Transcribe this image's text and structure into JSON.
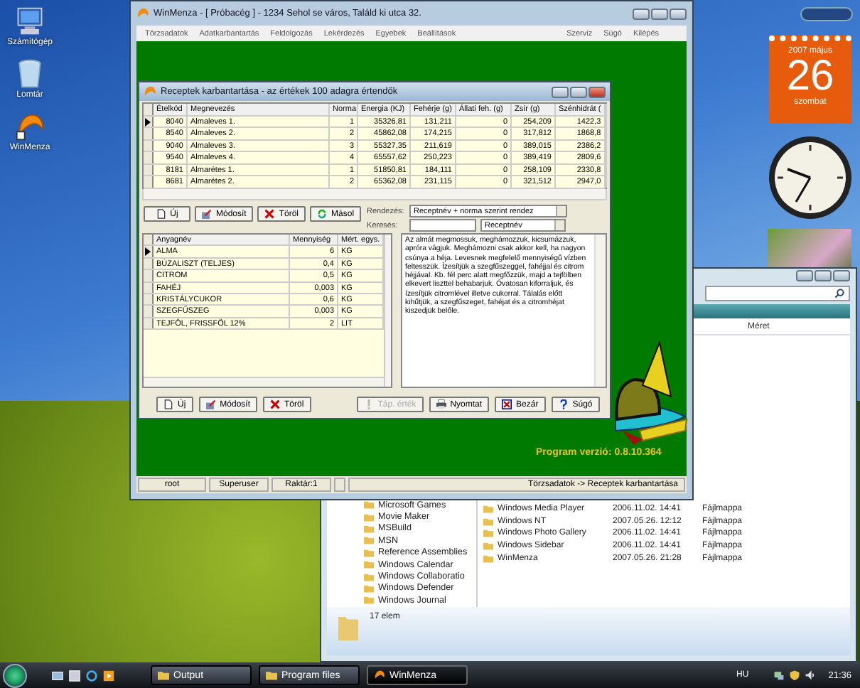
{
  "desktop_icons": [
    {
      "label": "Számítógép",
      "kind": "computer"
    },
    {
      "label": "Lomtár",
      "kind": "bin"
    },
    {
      "label": "WinMenza",
      "kind": "app"
    }
  ],
  "calendar_gadget": {
    "month": "2007 május",
    "day": "26",
    "weekday": "szombat"
  },
  "explorer_window": {
    "column_header": "Méret",
    "folders": [
      "Microsoft Games",
      "Movie Maker",
      "MSBuild",
      "MSN",
      "Reference Assemblies",
      "Windows Calendar",
      "Windows Collaboratio",
      "Windows Defender",
      "Windows Journal"
    ],
    "files": [
      {
        "name": "Windows Media Player",
        "date": "2006.11.02. 14:41",
        "type": "Fájlmappa"
      },
      {
        "name": "Windows NT",
        "date": "2007.05.26. 12:12",
        "type": "Fájlmappa"
      },
      {
        "name": "Windows Photo Gallery",
        "date": "2006.11.02. 14:41",
        "type": "Fájlmappa"
      },
      {
        "name": "Windows Sidebar",
        "date": "2006.11.02. 14:41",
        "type": "Fájlmappa"
      },
      {
        "name": "WinMenza",
        "date": "2007.05.26. 21:28",
        "type": "Fájlmappa"
      }
    ],
    "status": "17 elem"
  },
  "app_window": {
    "title": "WinMenza - [ Próbacég ] - 1234 Sehol se város, Találd ki utca 32.",
    "menu": [
      "Törzsadatok",
      "Adatkarbantartás",
      "Feldolgozás",
      "Lekérdezés",
      "Egyebek",
      "Beállítások",
      "Szerviz",
      "Súgó",
      "Kilépés"
    ],
    "version": "Program verzió:  0.8.10.364",
    "status_left": [
      "root",
      "Superuser",
      "Raktár:1"
    ],
    "status_right": "Törzsadatok -> Receptek karbantartása"
  },
  "dialog": {
    "title": "Receptek karbantartása - az értékek 100 adagra értendők",
    "recipes": {
      "columns": [
        "Ételkód",
        "Megnevezés",
        "Norma",
        "Energia (KJ)",
        "Fehérje (g)",
        "Állati feh. (g)",
        "Zsír (g)",
        "Szénhidrát ("
      ],
      "rows": [
        {
          "selected": true,
          "cells": [
            "8040",
            "Almaleves 1.",
            "1",
            "35326,81",
            "131,211",
            "0",
            "254,209",
            "1422,3"
          ]
        },
        {
          "selected": false,
          "cells": [
            "8540",
            "Almaleves 2.",
            "2",
            "45862,08",
            "174,215",
            "0",
            "317,812",
            "1868,8"
          ]
        },
        {
          "selected": false,
          "cells": [
            "9040",
            "Almaleves 3.",
            "3",
            "55327,35",
            "211,619",
            "0",
            "389,015",
            "2386,2"
          ]
        },
        {
          "selected": false,
          "cells": [
            "9540",
            "Almaleves 4.",
            "4",
            "65557,62",
            "250,223",
            "0",
            "389,419",
            "2809,6"
          ]
        },
        {
          "selected": false,
          "cells": [
            "8181",
            "Almarétes 1.",
            "1",
            "51850,81",
            "184,111",
            "0",
            "258,109",
            "2330,8"
          ]
        },
        {
          "selected": false,
          "cells": [
            "8681",
            "Almarétes 2.",
            "2",
            "65362,08",
            "231,115",
            "0",
            "321,512",
            "2947,0"
          ]
        }
      ]
    },
    "toolbar_buttons": [
      {
        "label": "Új",
        "kind": "new"
      },
      {
        "label": "Módosít",
        "kind": "edit"
      },
      {
        "label": "Töröl",
        "kind": "delete"
      },
      {
        "label": "Másol",
        "kind": "copy"
      }
    ],
    "sort_label": "Rendezés:",
    "sort_value": "Receptnév + norma szerint rendez",
    "search_label": "Keresés:",
    "search_by": "Receptnév",
    "ingredients": {
      "columns": [
        "Anyagnév",
        "Mennyiség",
        "Mért. egys."
      ],
      "rows": [
        {
          "selected": true,
          "cells": [
            "ALMA",
            "6",
            "KG"
          ]
        },
        {
          "selected": false,
          "cells": [
            "BÚZALISZT (TELJES)",
            "0,4",
            "KG"
          ]
        },
        {
          "selected": false,
          "cells": [
            "CITROM",
            "0,5",
            "KG"
          ]
        },
        {
          "selected": false,
          "cells": [
            "FAHÉJ",
            "0,003",
            "KG"
          ]
        },
        {
          "selected": false,
          "cells": [
            "KRISTÁLYCUKOR",
            "0,6",
            "KG"
          ]
        },
        {
          "selected": false,
          "cells": [
            "SZEGFŰSZEG",
            "0,003",
            "KG"
          ]
        },
        {
          "selected": false,
          "cells": [
            "TEJFÖL, FRISSFÖL 12%",
            "2",
            "LIT"
          ]
        }
      ]
    },
    "instructions": "Az almát megmossuk, meghámozzuk, kicsumázzuk, apróra vágjuk. Meghámozni csak akkor kell, ha nagyon csúnya a héja. Levesnek megfelelő mennyiségű vízben feltesszük. Ízesítjük a szegfűszeggel, fahéjjal és citrom héjjával. Kb. fél perc alatt megfőzzük, majd a tejfölben elkevert liszttel behabarjuk. Óvatosan kiforraljuk, és ízesítjük citromlével illetve cukorral. Tálalás előtt kihűtjük, a szegfűszeget, fahéjat és a citromhéjat kiszedjük belőle.",
    "bottom_buttons": [
      {
        "label": "Új",
        "kind": "new",
        "disabled": false
      },
      {
        "label": "Módosít",
        "kind": "edit",
        "disabled": false
      },
      {
        "label": "Töröl",
        "kind": "delete",
        "disabled": false
      },
      {
        "label": "Táp. érték",
        "kind": "info",
        "disabled": true
      },
      {
        "label": "Nyomtat",
        "kind": "print",
        "disabled": false
      },
      {
        "label": "Bezár",
        "kind": "close",
        "disabled": false
      },
      {
        "label": "Súgó",
        "kind": "help",
        "disabled": false
      }
    ]
  },
  "taskbar": {
    "tasks": [
      {
        "label": "Output",
        "kind": "folder",
        "selected": false
      },
      {
        "label": "Program files",
        "kind": "folder",
        "selected": false
      },
      {
        "label": "WinMenza",
        "kind": "app",
        "selected": true
      }
    ],
    "language": "HU",
    "clock": "21:36"
  }
}
